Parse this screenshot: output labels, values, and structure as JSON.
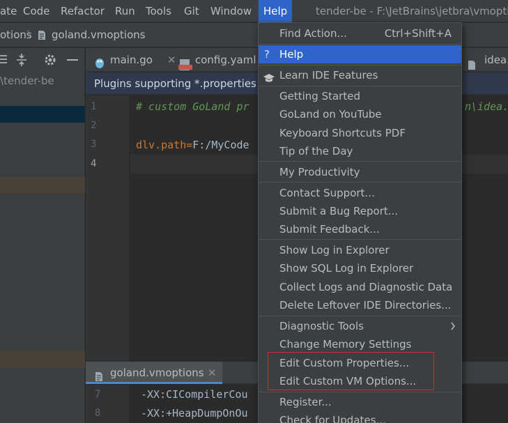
{
  "menubar": {
    "items": [
      {
        "label": "ate"
      },
      {
        "label": "Code"
      },
      {
        "label": "Refactor"
      },
      {
        "label": "Run"
      },
      {
        "label": "Tools"
      },
      {
        "label": "Git"
      },
      {
        "label": "Window"
      },
      {
        "label": "Help"
      }
    ],
    "title": "tender-be - F:\\JetBrains\\jetbra\\vmoptio"
  },
  "navbar": {
    "crumb_left": "otions",
    "crumb_file": "goland.vmoptions"
  },
  "project_panel": {
    "path_label": "\\tender-be"
  },
  "tabs": [
    {
      "label": "main.go"
    },
    {
      "label": "config.yaml"
    },
    {
      "label": "idea."
    }
  ],
  "banner": {
    "text": "Plugins supporting *.properties f"
  },
  "editor": {
    "lines": [
      {
        "num": "1",
        "text": "# custom GoLand pr",
        "tail": "n\\idea."
      },
      {
        "num": "2",
        "text": ""
      },
      {
        "num": "3",
        "key": "dlv.path",
        "eq": "=",
        "value": "F:/MyCode"
      },
      {
        "num": "4",
        "text": ""
      }
    ]
  },
  "bottom_panel": {
    "tab_label": "goland.vmoptions",
    "lines": [
      {
        "num": "7",
        "text": "-XX:CICompilerCou"
      },
      {
        "num": "8",
        "text": "-XX:+HeapDumpOnOu"
      }
    ]
  },
  "help_menu": {
    "groups": [
      {
        "items": [
          {
            "label": "Find Action...",
            "mnemonic": "F",
            "shortcut": "Ctrl+Shift+A"
          }
        ]
      },
      {
        "items": [
          {
            "label": "Help",
            "mnemonic": "H",
            "icon": "question-icon",
            "selected": true
          }
        ]
      },
      {
        "items": [
          {
            "label": "Learn IDE Features",
            "icon": "graduation-cap-icon"
          }
        ]
      },
      {
        "items": [
          {
            "label": "Getting Started",
            "mnemonic": "G"
          },
          {
            "label": "GoLand on YouTube"
          },
          {
            "label": "Keyboard Shortcuts PDF",
            "mnemonic": "K"
          },
          {
            "label": "Tip of the Day",
            "mnemonic": "T"
          }
        ]
      },
      {
        "items": [
          {
            "label": "My Productivity"
          }
        ]
      },
      {
        "items": [
          {
            "label": "Contact Support..."
          },
          {
            "label": "Submit a Bug Report..."
          },
          {
            "label": "Submit Feedback..."
          }
        ]
      },
      {
        "items": [
          {
            "label": "Show Log in Explorer"
          },
          {
            "label": "Show SQL Log in Explorer"
          },
          {
            "label": "Collect Logs and Diagnostic Data"
          },
          {
            "label": "Delete Leftover IDE Directories..."
          }
        ]
      },
      {
        "items": [
          {
            "label": "Diagnostic Tools",
            "submenu": true
          },
          {
            "label": "Change Memory Settings"
          },
          {
            "label": "Edit Custom Properties..."
          },
          {
            "label": "Edit Custom VM Options..."
          }
        ]
      },
      {
        "items": [
          {
            "label": "Register..."
          },
          {
            "label": "Check for Updates..."
          }
        ]
      }
    ]
  },
  "colors": {
    "accent": "#2f65ca",
    "highlight_box": "#e0242f",
    "comment": "#629755",
    "key": "#cc7832",
    "value": "#a9b7c6"
  }
}
